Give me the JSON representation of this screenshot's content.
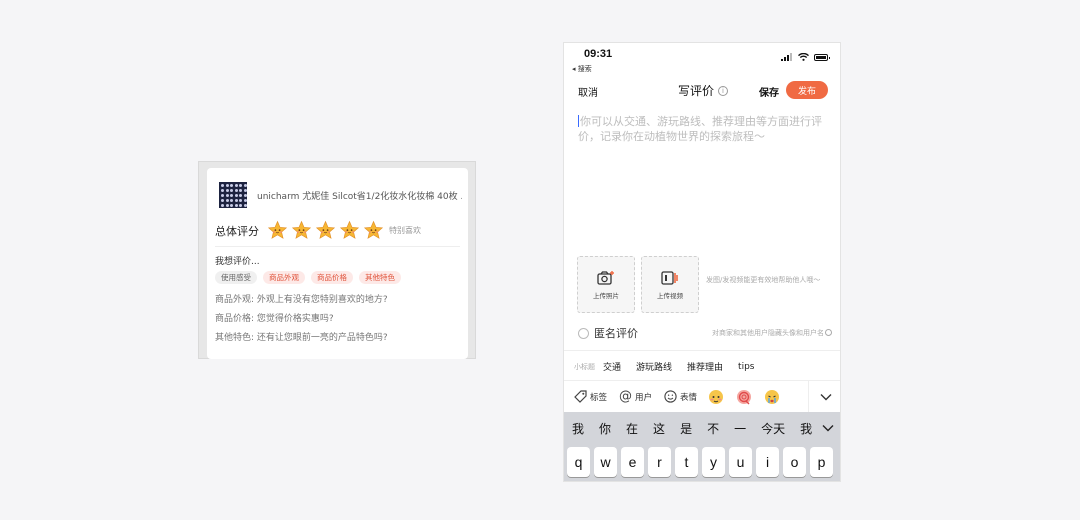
{
  "review_card": {
    "product_title": "unicharm 尤妮佳 Silcot省1/2化妆水化妆棉 40枚 ...",
    "overall_label": "总体评分",
    "rating": 5,
    "rating_max": 5,
    "rating_desc": "特别喜欢",
    "want_title": "我想评价...",
    "tags": [
      {
        "label": "使用感受",
        "style": "grey"
      },
      {
        "label": "商品外观",
        "style": "red"
      },
      {
        "label": "商品价格",
        "style": "red"
      },
      {
        "label": "其他特色",
        "style": "red"
      }
    ],
    "prompts": [
      "商品外观: 外观上有没有您特别喜欢的地方?",
      "商品价格: 您觉得价格实惠吗?",
      "其他特色: 还有让您眼前一亮的产品特色吗?"
    ]
  },
  "phone": {
    "status": {
      "time": "09:31",
      "back_label": "◂ 搜索"
    },
    "nav": {
      "cancel": "取消",
      "title": "写评价",
      "info_icon": "i",
      "save": "保存",
      "publish": "发布"
    },
    "placeholder": "你可以从交通、游玩路线、推荐理由等方面进行评价，记录你在动植物世界的探索旅程～",
    "uploads": {
      "photo_label": "上传照片",
      "video_label": "上传视频",
      "tip": "发图/发视频能更有效地帮助他人哦～"
    },
    "anonymous": {
      "label": "匿名评价",
      "tip": "对商家和其他用户隐藏头像和用户名"
    },
    "subtitle": {
      "label": "小标题",
      "items": [
        "交通",
        "游玩路线",
        "推荐理由",
        "tips"
      ]
    },
    "toolbar": {
      "tag": "标签",
      "user": "用户",
      "emoji": "表情",
      "at_symbol": "@"
    },
    "keyboard": {
      "candidates": [
        "我",
        "你",
        "在",
        "这",
        "是",
        "不",
        "一",
        "今天",
        "我"
      ],
      "keys": [
        "q",
        "w",
        "e",
        "r",
        "t",
        "y",
        "u",
        "i",
        "o",
        "p"
      ]
    },
    "colors": {
      "accent": "#f06a43",
      "caret": "#3a6bff"
    }
  }
}
